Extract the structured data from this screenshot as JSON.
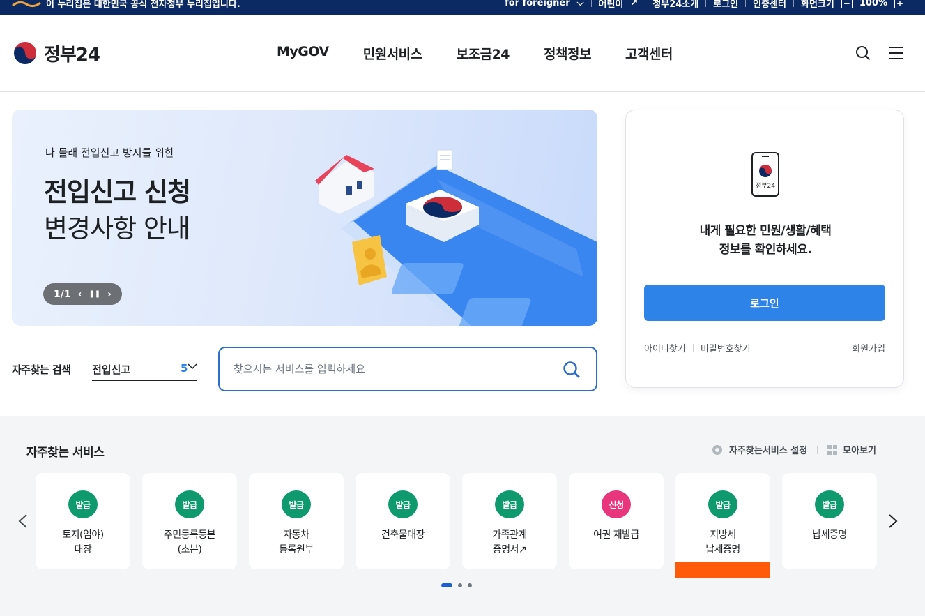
{
  "topbar": {
    "notice": "이 누리집은 대한민국 공식 전자정부 누리집입니다.",
    "links": [
      "for foreigner",
      "어린이",
      "정부24소개",
      "로그인",
      "인증센터"
    ],
    "zoom_label": "화면크기",
    "zoom_minus": "−",
    "zoom_value": "100%",
    "zoom_plus": "+"
  },
  "header": {
    "logo_text": "정부24",
    "nav": [
      "MyGOV",
      "민원서비스",
      "보조금24",
      "정책정보",
      "고객센터"
    ]
  },
  "banner": {
    "subtitle": "나 몰래 전입신고 방지를 위한",
    "title_line1": "전입신고 신청",
    "title_line2": "변경사항 안내",
    "pager": "1/1"
  },
  "login": {
    "logo_caption": "정부24",
    "message_line1": "내게 필요한 민원/생활/혜택",
    "message_line2": "정보를 확인하세요.",
    "button": "로그인",
    "find_id": "아이디찾기",
    "find_pw": "비밀번호찾기",
    "join": "회원가입"
  },
  "search": {
    "popular_label": "자주찾는 검색",
    "rolling_keyword": "전입신고",
    "rolling_rank": "5",
    "placeholder": "찾으시는 서비스를 입력하세요"
  },
  "services": {
    "title": "자주찾는 서비스",
    "settings": "자주찾는서비스 설정",
    "view_all": "모아보기",
    "items": [
      {
        "badge": "발급",
        "line1": "토지(임야)",
        "line2": "대장"
      },
      {
        "badge": "발급",
        "line1": "주민등록등본",
        "line2": "(초본)"
      },
      {
        "badge": "발급",
        "line1": "자동차",
        "line2": "등록원부"
      },
      {
        "badge": "발급",
        "line1": "건축물대장",
        "line2": ""
      },
      {
        "badge": "발급",
        "line1": "가족관계",
        "line2": "증명서"
      },
      {
        "badge": "신청",
        "line1": "여권 재발급",
        "line2": ""
      },
      {
        "badge": "발급",
        "line1": "지방세",
        "line2": "납세증명"
      },
      {
        "badge": "발급",
        "line1": "납세증명",
        "line2": ""
      }
    ]
  },
  "colors": {
    "primary": "#2d83e8",
    "topbar": "#0b2a63",
    "badge_green": "#0e9a6d",
    "badge_pink": "#e8357b",
    "focus_bar": "#ff5a0a"
  }
}
